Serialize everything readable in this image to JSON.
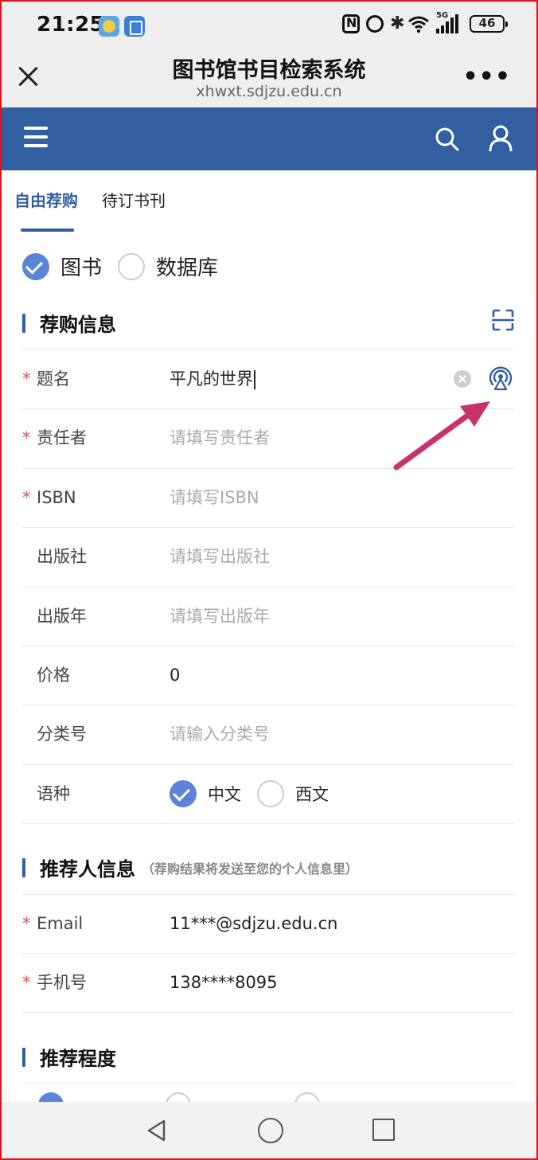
{
  "status_bar": {
    "time": "21:25",
    "battery": "46",
    "network": "5G"
  },
  "title_bar": {
    "title": "图书馆书目检索系统",
    "url": "xhwxt.sdjzu.edu.cn",
    "more": "•••"
  },
  "tabs": [
    {
      "label": "自由荐购",
      "active": true
    },
    {
      "label": "待订书刊",
      "active": false
    }
  ],
  "type_options": [
    {
      "label": "图书",
      "selected": true
    },
    {
      "label": "数据库",
      "selected": false
    }
  ],
  "section_purchase": {
    "title": "荐购信息",
    "fields": {
      "title": {
        "label": "题名",
        "required": true,
        "value": "平凡的世界"
      },
      "author": {
        "label": "责任者",
        "required": true,
        "placeholder": "请填写责任者"
      },
      "isbn": {
        "label": "ISBN",
        "required": true,
        "placeholder": "请填写ISBN"
      },
      "publisher": {
        "label": "出版社",
        "required": false,
        "placeholder": "请填写出版社"
      },
      "year": {
        "label": "出版年",
        "required": false,
        "placeholder": "请填写出版年"
      },
      "price": {
        "label": "价格",
        "required": false,
        "value": "0"
      },
      "class_no": {
        "label": "分类号",
        "required": false,
        "placeholder": "请输入分类号"
      },
      "language": {
        "label": "语种",
        "options": [
          {
            "label": "中文",
            "selected": true
          },
          {
            "label": "西文",
            "selected": false
          }
        ]
      }
    }
  },
  "section_recommender": {
    "title": "推荐人信息",
    "note": "（荐购结果将发送至您的个人信息里）",
    "fields": {
      "email": {
        "label": "Email",
        "required": true,
        "value": "11***@sdjzu.edu.cn"
      },
      "phone": {
        "label": "手机号",
        "required": true,
        "value": "138****8095"
      }
    }
  },
  "section_level": {
    "title": "推荐程度"
  },
  "colors": {
    "accent": "#315fa0",
    "radio_selected": "#5b84d9",
    "required_star": "#e05050",
    "annotation_arrow": "#c8336e",
    "frame": "#e0121b"
  },
  "icons": {
    "close": "close-icon",
    "more": "more-icon",
    "menu": "hamburger-menu-icon",
    "search": "search-icon",
    "user": "user-icon",
    "scan": "scan-icon",
    "clear": "clear-icon",
    "broadcast": "broadcast-icon"
  }
}
